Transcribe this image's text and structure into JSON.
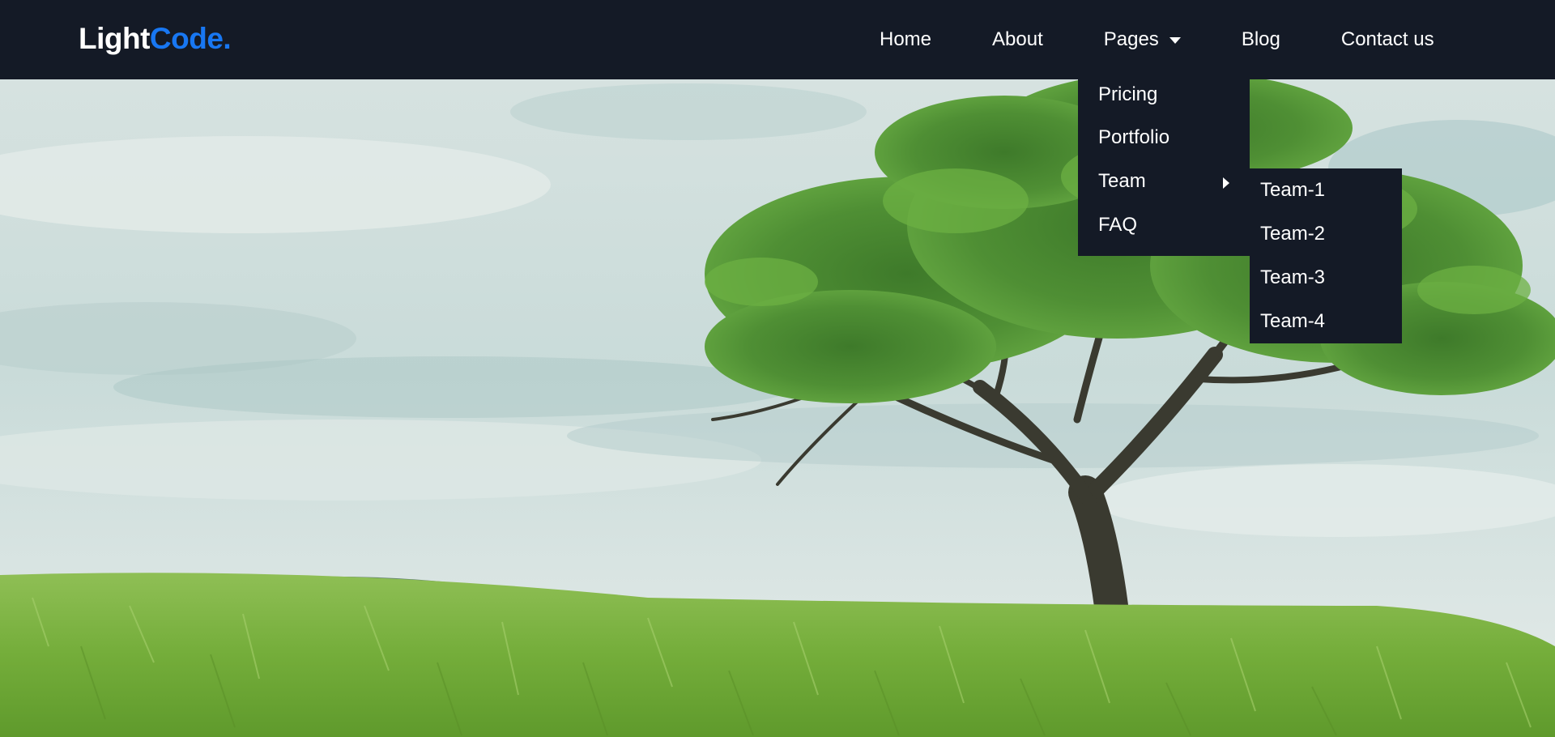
{
  "brand": {
    "name_part1": "Light",
    "name_part2": "Code.",
    "color_primary": "#ffffff",
    "color_accent": "#1877f2"
  },
  "nav": {
    "items": [
      {
        "label": "Home"
      },
      {
        "label": "About"
      },
      {
        "label": "Pages",
        "icon": "chevron-down-icon"
      },
      {
        "label": "Blog"
      },
      {
        "label": "Contact us"
      }
    ]
  },
  "pages_dropdown": {
    "items": [
      {
        "label": "Pricing"
      },
      {
        "label": "Portfolio"
      },
      {
        "label": "Team",
        "icon": "caret-right-icon"
      },
      {
        "label": "FAQ"
      }
    ]
  },
  "team_submenu": {
    "items": [
      {
        "label": "Team-1"
      },
      {
        "label": "Team-2"
      },
      {
        "label": "Team-3"
      },
      {
        "label": "Team-4"
      }
    ]
  },
  "hero": {
    "image": "landscape-tree-field-image"
  },
  "colors": {
    "navbar_bg": "#141a26",
    "text": "#ffffff",
    "accent": "#1877f2"
  }
}
